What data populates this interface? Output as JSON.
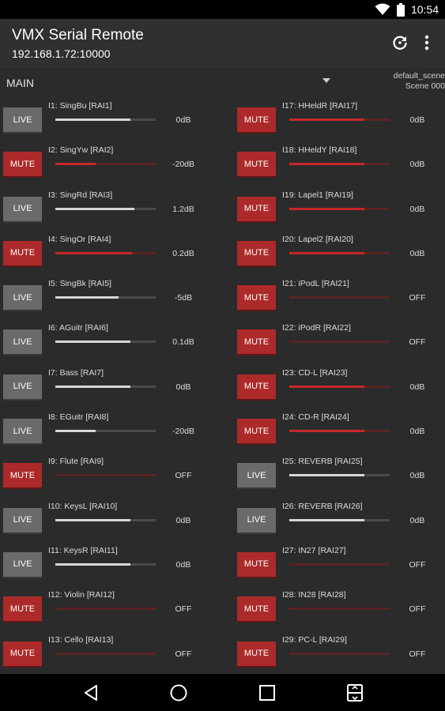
{
  "status_bar": {
    "time": "10:54",
    "icons": [
      "wifi-icon",
      "battery-icon"
    ]
  },
  "app_bar": {
    "title": "VMX Serial Remote",
    "address": "192.168.1.72:10000",
    "actions": [
      "refresh-icon",
      "more-vert-icon"
    ]
  },
  "selector": {
    "mix": "MAIN",
    "scene_line1": "default_scene",
    "scene_line2": "Scene 000"
  },
  "colors": {
    "mute": "#ad2a2a",
    "live": "#6a6a6a",
    "fader_mute": "#c62828",
    "fader_live": "#d6d6d6"
  },
  "channels_left": [
    {
      "label": "I1: SingBu  [RAI1]",
      "state": "LIVE",
      "level": "0dB",
      "fader": 0.75
    },
    {
      "label": "I2: SingYw  [RAI2]",
      "state": "MUTE",
      "level": "-20dB",
      "fader": 0.4
    },
    {
      "label": "I3: SingRd  [RAI3]",
      "state": "LIVE",
      "level": "1.2dB",
      "fader": 0.79
    },
    {
      "label": "I4: SingOr  [RAI4]",
      "state": "MUTE",
      "level": "0.2dB",
      "fader": 0.76
    },
    {
      "label": "I5: SingBk  [RAI5]",
      "state": "LIVE",
      "level": "-5dB",
      "fader": 0.63
    },
    {
      "label": "I6: AGuitr  [RAI6]",
      "state": "LIVE",
      "level": "0.1dB",
      "fader": 0.75
    },
    {
      "label": "I7: Bass    [RAI7]",
      "state": "LIVE",
      "level": "0dB",
      "fader": 0.75
    },
    {
      "label": "I8: EGuitr  [RAI8]",
      "state": "LIVE",
      "level": "-20dB",
      "fader": 0.4
    },
    {
      "label": "I9: Flute   [RAI9]",
      "state": "MUTE",
      "level": "OFF",
      "fader": 0.0
    },
    {
      "label": "I10: KeysL  [RAI10]",
      "state": "LIVE",
      "level": "0dB",
      "fader": 0.75
    },
    {
      "label": "I11: KeysR  [RAI11]",
      "state": "LIVE",
      "level": "0dB",
      "fader": 0.75
    },
    {
      "label": "I12: Violin  [RAI12]",
      "state": "MUTE",
      "level": "OFF",
      "fader": 0.0
    },
    {
      "label": "I13: Cello   [RAI13]",
      "state": "MUTE",
      "level": "OFF",
      "fader": 0.0
    }
  ],
  "channels_right": [
    {
      "label": "I17: HHeldR  [RAI17]",
      "state": "MUTE",
      "level": "0dB",
      "fader": 0.75
    },
    {
      "label": "I18: HHeldY  [RAI18]",
      "state": "MUTE",
      "level": "0dB",
      "fader": 0.75
    },
    {
      "label": "I19: Lapel1  [RAI19]",
      "state": "MUTE",
      "level": "0dB",
      "fader": 0.75
    },
    {
      "label": "I20: Lapel2  [RAI20]",
      "state": "MUTE",
      "level": "0dB",
      "fader": 0.75
    },
    {
      "label": "I21: iPodL   [RAI21]",
      "state": "MUTE",
      "level": "OFF",
      "fader": 0.0
    },
    {
      "label": "I22: iPodR   [RAI22]",
      "state": "MUTE",
      "level": "OFF",
      "fader": 0.0
    },
    {
      "label": "I23: CD-L    [RAI23]",
      "state": "MUTE",
      "level": "0dB",
      "fader": 0.75
    },
    {
      "label": "I24: CD-R    [RAI24]",
      "state": "MUTE",
      "level": "0dB",
      "fader": 0.75
    },
    {
      "label": "I25: REVERB  [RAI25]",
      "state": "LIVE",
      "level": "0dB",
      "fader": 0.75
    },
    {
      "label": "I26: REVERB  [RAI26]",
      "state": "LIVE",
      "level": "0dB",
      "fader": 0.75
    },
    {
      "label": "I27: IN27    [RAI27]",
      "state": "MUTE",
      "level": "OFF",
      "fader": 0.0
    },
    {
      "label": "I28: IN28    [RAI28]",
      "state": "MUTE",
      "level": "OFF",
      "fader": 0.0
    },
    {
      "label": "I29: PC-L    [RAI29]",
      "state": "MUTE",
      "level": "OFF",
      "fader": 0.0
    }
  ],
  "nav_bar": [
    "back-icon",
    "home-icon",
    "recents-icon",
    "split-screen-icon"
  ]
}
